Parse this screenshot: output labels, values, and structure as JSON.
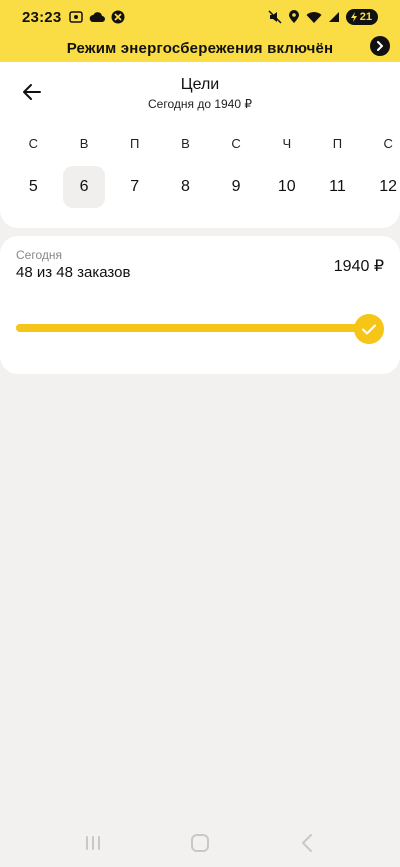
{
  "status_bar": {
    "time": "23:23",
    "battery_level": "21",
    "left_icons": [
      "screenshot-icon",
      "cloud-icon",
      "app-notification-icon"
    ],
    "right_icons": [
      "mute-icon",
      "location-icon",
      "wifi-icon",
      "signal-icon",
      "battery-icon"
    ]
  },
  "banner": {
    "text": "Режим энергосбережения включён",
    "action_icon": "chevron-right-icon"
  },
  "header": {
    "title": "Цели",
    "subtitle": "Сегодня до 1940 ₽",
    "back_icon": "arrow-left-icon"
  },
  "calendar": {
    "weekdays": [
      "С",
      "В",
      "П",
      "В",
      "С",
      "Ч",
      "П",
      "С"
    ],
    "days": [
      "5",
      "6",
      "7",
      "8",
      "9",
      "10",
      "11",
      "12"
    ],
    "selected_index": 1
  },
  "goal": {
    "label": "Сегодня",
    "count_text": "48 из 48 заказов",
    "amount": "1940 ₽",
    "progress": 1.0,
    "accent_color": "#f5c518"
  },
  "nav_bar": {
    "items": [
      "recent-apps-icon",
      "home-icon",
      "back-icon"
    ]
  },
  "colors": {
    "banner": "#fadd45",
    "background": "#f2f1ef",
    "card": "#ffffff",
    "accent": "#f5c518"
  }
}
